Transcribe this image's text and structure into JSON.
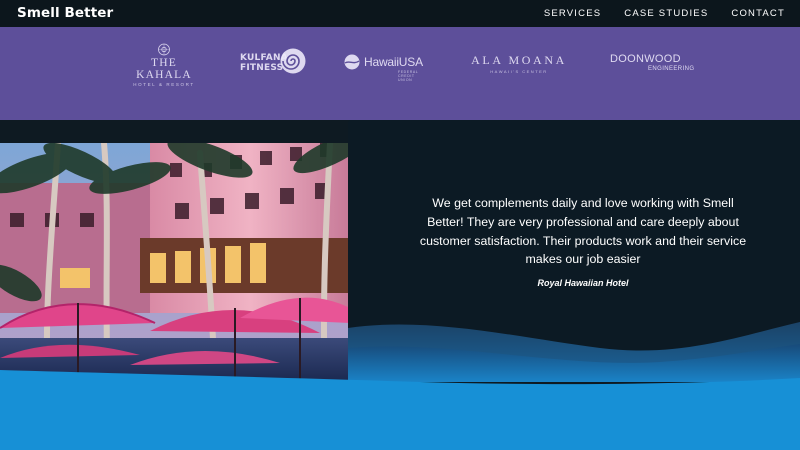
{
  "header": {
    "brand": "Smell Better",
    "nav": [
      "SERVICES",
      "CASE STUDIES",
      "CONTACT"
    ]
  },
  "clients": {
    "kahala": {
      "name": "THE KAHALA",
      "sub": "HOTEL & RESORT"
    },
    "kulfana": {
      "line1": "KULFANA",
      "line2": "FITNESS"
    },
    "hawaiiusa": {
      "name": "HawaiiUSA",
      "sub": "FEDERAL CREDIT UNION"
    },
    "alamoana": {
      "name": "ALA MOANA",
      "sub": "HAWAII'S CENTER"
    },
    "doonwood": {
      "name": "DOONWOOD",
      "sub": "ENGINEERING"
    }
  },
  "testimonial": {
    "quote": "We get complements daily and love working with Smell Better! They are very professional and care deeply about customer satisfaction. Their products work and their service makes our job easier",
    "author": "Royal Hawaiian Hotel"
  },
  "colors": {
    "header_bg": "#0c161c",
    "logo_band": "#5d4f9a",
    "card_bg": "#0c1a24",
    "ocean": "#1790d6"
  }
}
